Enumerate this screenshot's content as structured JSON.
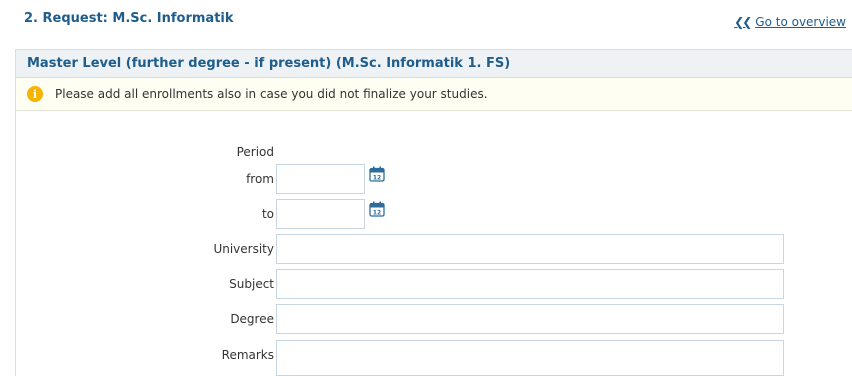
{
  "header": {
    "request_title": "2. Request: M.Sc. Informatik",
    "overview_link": "Go to overview"
  },
  "panel": {
    "title": "Master Level (further degree - if present) (M.Sc. Informatik 1. FS)",
    "info_message": "Please add all enrollments also in case you did not finalize your studies."
  },
  "form": {
    "period_label": "Period",
    "from_label": "from",
    "to_label": "to",
    "university_label": "University",
    "subject_label": "Subject",
    "degree_label": "Degree",
    "remarks_label": "Remarks",
    "from_value": "",
    "to_value": "",
    "university_value": "",
    "subject_value": "",
    "degree_value": "",
    "remarks_value": "",
    "calendar_day": "12"
  },
  "icons": {
    "info": "info-icon",
    "calendar": "calendar-icon",
    "back": "double-chevron-left-icon"
  },
  "colors": {
    "accent": "#1f5d8c",
    "warning": "#f5b400"
  }
}
